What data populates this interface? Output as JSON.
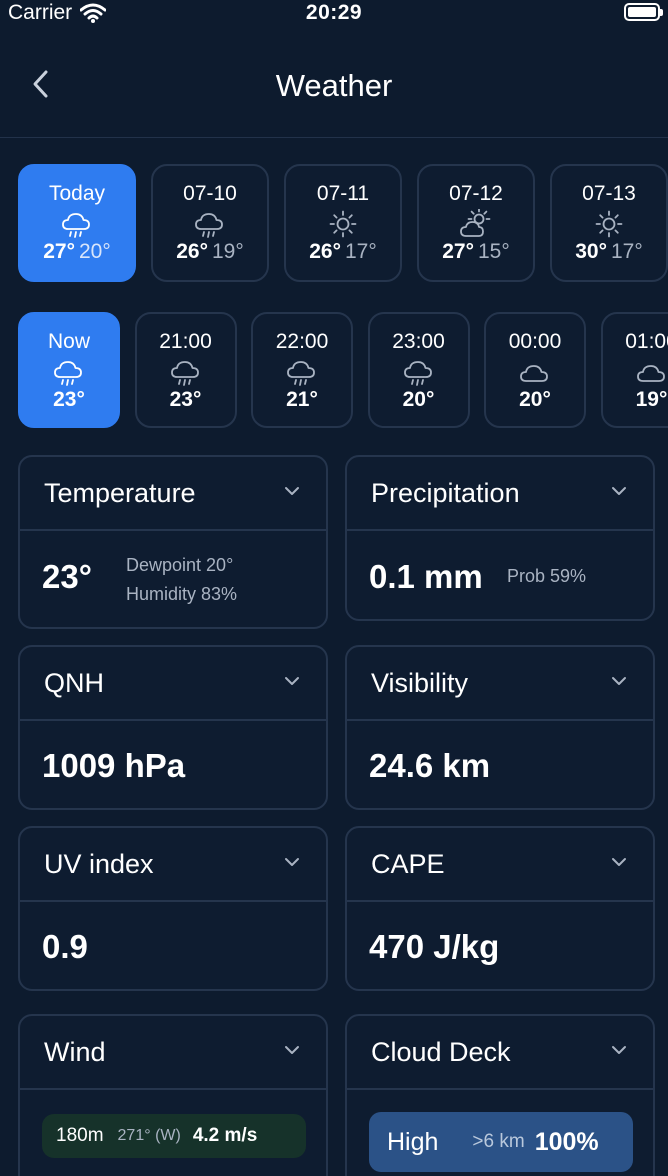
{
  "status_bar": {
    "carrier": "Carrier",
    "time": "20:29"
  },
  "nav": {
    "title": "Weather"
  },
  "days": [
    {
      "label": "Today",
      "icon": "rain-cloud-icon",
      "high": "27°",
      "low": "20°",
      "active": true
    },
    {
      "label": "07-10",
      "icon": "rain-cloud-icon",
      "high": "26°",
      "low": "19°",
      "active": false
    },
    {
      "label": "07-11",
      "icon": "sun-icon",
      "high": "26°",
      "low": "17°",
      "active": false
    },
    {
      "label": "07-12",
      "icon": "partly-cloudy-icon",
      "high": "27°",
      "low": "15°",
      "active": false
    },
    {
      "label": "07-13",
      "icon": "sun-icon",
      "high": "30°",
      "low": "17°",
      "active": false
    }
  ],
  "hours": [
    {
      "label": "Now",
      "icon": "rain-cloud-icon",
      "temp": "23°",
      "active": true
    },
    {
      "label": "21:00",
      "icon": "rain-cloud-icon",
      "temp": "23°",
      "active": false
    },
    {
      "label": "22:00",
      "icon": "rain-cloud-icon",
      "temp": "21°",
      "active": false
    },
    {
      "label": "23:00",
      "icon": "rain-cloud-icon",
      "temp": "20°",
      "active": false
    },
    {
      "label": "00:00",
      "icon": "cloud-icon",
      "temp": "20°",
      "active": false
    },
    {
      "label": "01:00",
      "icon": "cloud-icon",
      "temp": "19°",
      "active": false
    }
  ],
  "cards": {
    "temperature": {
      "title": "Temperature",
      "value": "23°",
      "dewpoint": "Dewpoint 20°",
      "humidity": "Humidity 83%"
    },
    "precipitation": {
      "title": "Precipitation",
      "value": "0.1 mm",
      "prob": "Prob 59%"
    },
    "qnh": {
      "title": "QNH",
      "value": "1009 hPa"
    },
    "visibility": {
      "title": "Visibility",
      "value": "24.6 km"
    },
    "uv": {
      "title": "UV index",
      "value": "0.9"
    },
    "cape": {
      "title": "CAPE",
      "value": "470 J/kg"
    },
    "wind": {
      "title": "Wind",
      "height": "180m",
      "direction": "271° (W)",
      "speed": "4.2 m/s"
    },
    "cloud": {
      "title": "Cloud Deck",
      "level": "High",
      "altitude": ">6 km",
      "cover": "100%"
    }
  },
  "colors": {
    "background": "#0d1b2e",
    "accent": "#2f7cf0",
    "card_border": "#25354d",
    "wind_pill": "#16322a",
    "cloud_pill": "#2b5287"
  }
}
